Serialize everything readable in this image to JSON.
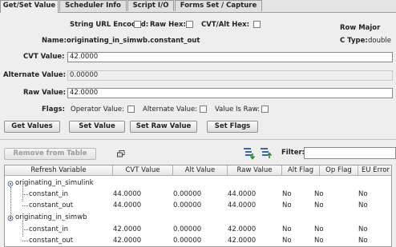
{
  "tabs": [
    {
      "label": "Get/Set Value",
      "active": true
    },
    {
      "label": "Scheduler Info",
      "active": false
    },
    {
      "label": "Script I/O",
      "active": false
    },
    {
      "label": "Forms Set / Capture",
      "active": false
    }
  ],
  "options": {
    "string_url_encoded": "String URL Encoded:",
    "raw_hex": "Raw Hex:",
    "cvt_alt_hex": "CVT/Alt Hex:",
    "row_major": "Row Major"
  },
  "name": {
    "label": "Name:",
    "value": "originating_in_simwb.constant_out"
  },
  "ctype": {
    "label": "C Type:",
    "value": "double"
  },
  "cvt_value": {
    "label": "CVT Value:",
    "value": "42.0000"
  },
  "alternate_value": {
    "label": "Alternate Value:",
    "value": "0.00000"
  },
  "raw_value": {
    "label": "Raw Value:",
    "value": "42.0000"
  },
  "flags": {
    "label": "Flags:",
    "operator_value": "Operator Value:",
    "alternate_value": "Alternate Value:",
    "value_is_raw": "Value Is Raw:"
  },
  "buttons": {
    "get_values": "Get Values",
    "set_value": "Set Value",
    "set_raw_value": "Set Raw Value",
    "set_flags": "Set Flags",
    "remove_from_table": "Remove from Table"
  },
  "filter": {
    "label": "Filter:",
    "value": ""
  },
  "table": {
    "headers": [
      "Refresh Variable",
      "CVT Value",
      "Alt Value",
      "Raw Value",
      "Alt Flag",
      "Op Flag",
      "EU Error"
    ],
    "groups": [
      {
        "name": "originating_in_simulink",
        "rows": [
          {
            "name": "constant_in",
            "cvt": "44.0000",
            "alt": "0.00000",
            "raw": "44.0000",
            "alt_flag": "No",
            "op_flag": "No",
            "eu_error": "No"
          },
          {
            "name": "constant_out",
            "cvt": "44.0000",
            "alt": "0.00000",
            "raw": "44.0000",
            "alt_flag": "No",
            "op_flag": "No",
            "eu_error": "No"
          }
        ]
      },
      {
        "name": "originating_in_simwb",
        "rows": [
          {
            "name": "constant_in",
            "cvt": "42.0000",
            "alt": "0.00000",
            "raw": "42.0000",
            "alt_flag": "No",
            "op_flag": "No",
            "eu_error": "No"
          },
          {
            "name": "constant_out",
            "cvt": "42.0000",
            "alt": "0.00000",
            "raw": "42.0000",
            "alt_flag": "No",
            "op_flag": "No",
            "eu_error": "No"
          }
        ]
      }
    ]
  }
}
